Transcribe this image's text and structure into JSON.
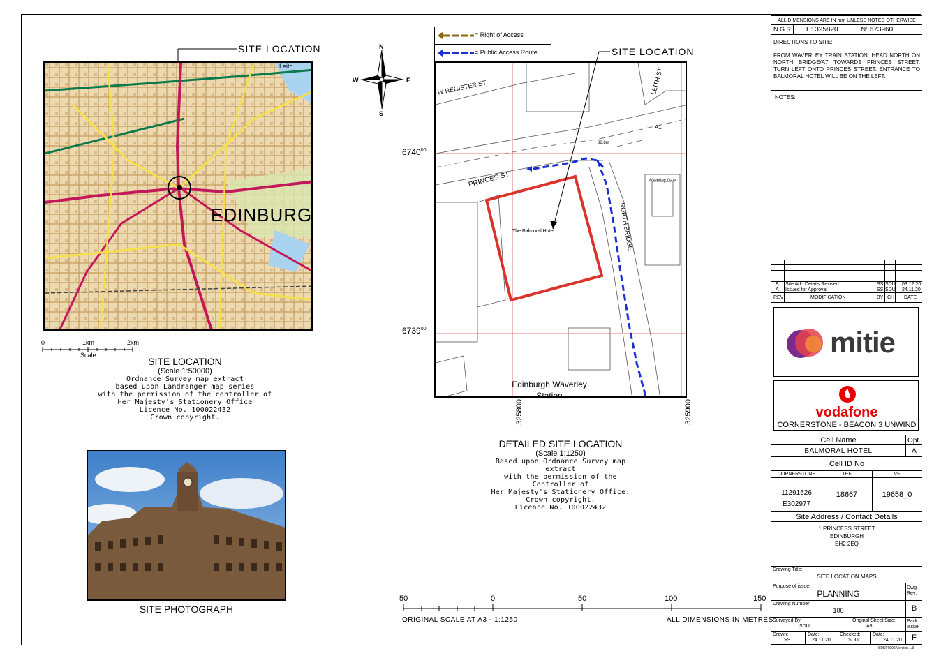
{
  "site_location_callout": "SITE LOCATION",
  "map1_labels": {
    "city": "EDINBURGH",
    "leith": "Leith"
  },
  "scale_bar_small": {
    "tick0": "0",
    "tick1": "1km",
    "tick2": "2km",
    "label": "Scale"
  },
  "site_location_caption": {
    "title": "SITE LOCATION",
    "scale": "(Scale 1:50000)",
    "body": [
      "Ordnance Survey map extract",
      "based upon Landranger map series",
      "with the permission of the controller of",
      "Her Majesty's Stationery Office",
      "Licence No. 100022432",
      "Crown copyright."
    ]
  },
  "photo_caption": "SITE PHOTOGRAPH",
  "legend": {
    "right_of_access": "= Right of Access",
    "public_access": "= Public Access Route"
  },
  "compass": {
    "n": "N",
    "e": "E",
    "s": "S",
    "w": "W"
  },
  "grid_labels": {
    "y_top": "6740",
    "y_top_sup": "00",
    "y_bot": "6739",
    "y_bot_sup": "00",
    "x_left": "325800",
    "x_right": "325900"
  },
  "map2_labels": {
    "w_register_st": "W REGISTER ST",
    "princes_st": "PRINCES ST",
    "north_bridge": "NORTH BRIDGE",
    "leith_st": "LEITH ST",
    "a1": "A1",
    "hotel": "The Balmoral Hotel",
    "waverley_gate": "Waverley Gate",
    "station": "Edinburgh Waverley Station",
    "spot_height": "86.8m"
  },
  "detailed_caption": {
    "title": "DETAILED SITE LOCATION",
    "scale": "(Scale 1:1250)",
    "body": [
      "Based upon Ordnance Survey map extract",
      "with the permission of the Controller of",
      "Her Majesty's Stationery Office.",
      "Crown copyright.",
      "Licence No. 100022432"
    ]
  },
  "bottom_scale": {
    "ticks": [
      "50",
      "0",
      "50",
      "100",
      "150"
    ],
    "left_label": "ORIGINAL SCALE AT A3 - 1:1250",
    "right_label": "ALL DIMENSIONS IN METRES"
  },
  "title_block": {
    "dimensions_note": "ALL DIMENSIONS ARE IN mm UNLESS NOTED OTHERWISE",
    "ngr_label": "N.G.R",
    "ngr_e": "E: 325820",
    "ngr_n": "N: 673960",
    "directions_label": "DIRECTIONS TO SITE:",
    "directions_text": "FROM WAVERLEY TRAIN STATION, HEAD NORTH ON NORTH BRIDGE/A7 TOWARDS PRINCES STREET. TURN LEFT ONTO PRINCES STREET. ENTRANCE TO BALMORAL HOTEL WILL BE ON THE LEFT.",
    "notes_label": "NOTES:",
    "revisions": [
      {
        "rev": "B",
        "mod": "Site Add Details Revised",
        "by": "SS",
        "ch": "SDUI",
        "date": "03.12.20"
      },
      {
        "rev": "A",
        "mod": "Issued for Approval",
        "by": "SS",
        "ch": "SDUI",
        "date": "24.11.20"
      }
    ],
    "rev_header": {
      "rev": "REV",
      "mod": "MODIFICATION",
      "by": "BY",
      "ch": "CH",
      "date": "DATE"
    },
    "mitie_logo": "mitie",
    "vodafone_logo": "vodafone",
    "project": "CORNERSTONE - BEACON 3 UNWIND",
    "cell_name_label": "Cell Name",
    "opt_label": "Opt.",
    "cell_name": "BALMORAL HOTEL",
    "opt": "A",
    "cell_id_label": "Cell ID No",
    "id_headers": [
      "CORNERSTONE",
      "TEF",
      "VF"
    ],
    "cornerstone_id": "11291526",
    "cornerstone_id2": "E302977",
    "tef_id": "18667",
    "vf_id": "19658_0",
    "address_label": "Site Address / Contact Details",
    "address": [
      "1 PRINCESS STREET",
      "EDINBURGH",
      "EH2 2EQ"
    ],
    "drawing_title_label": "Drawing Title:",
    "drawing_title": "SITE LOCATION MAPS",
    "purpose_label": "Purpose of issue:",
    "purpose": "PLANNING",
    "dwg_rev_label": "Dwg Rev:",
    "drawing_number_label": "Drawing Number:",
    "drawing_number": "100",
    "dwg_rev": "B",
    "surveyed_by_label": "Surveyed By:",
    "surveyed_by": "SDUI",
    "sheet_size_label": "Original Sheet Size:",
    "sheet_size": "A3",
    "pack_issue_label": "Pack Issue:",
    "drawn_label": "Drawn:",
    "drawn": "SS",
    "date_label": "Date:",
    "date1": "24.11.20",
    "checked_label": "Checked:",
    "checked": "SDUI",
    "date2": "24.11.20",
    "pack_issue": "F",
    "version": "SDNT0005 Version 1.3"
  }
}
